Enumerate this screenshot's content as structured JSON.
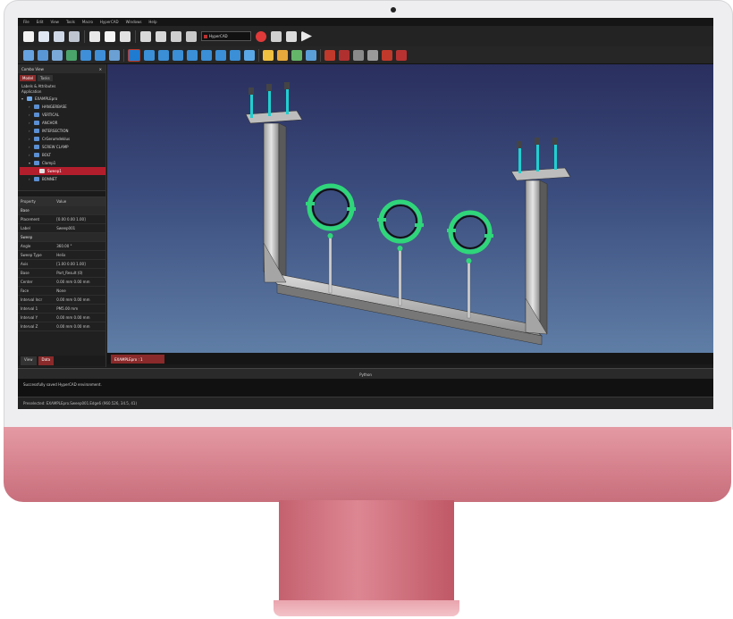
{
  "app": {
    "menu": [
      "File",
      "Edit",
      "View",
      "Tools",
      "Macro",
      "HyperCAD",
      "Windows",
      "Help"
    ],
    "workbench_combo": "HyperCAD"
  },
  "panel": {
    "title": "Combo View",
    "tabs": [
      "Model",
      "Tasks"
    ],
    "tree_header": "Labels & Attributes",
    "tree_root_label": "Application",
    "tree": [
      {
        "label": "EXAMPLEpro",
        "level": 0
      },
      {
        "label": "HANGERBASE",
        "level": 1
      },
      {
        "label": "VERTICAL",
        "level": 1
      },
      {
        "label": "ANCHOR",
        "level": 1
      },
      {
        "label": "INTERSECTION",
        "level": 1
      },
      {
        "label": "CrGerumdeklus",
        "level": 1
      },
      {
        "label": "SCREW CLAMP",
        "level": 1
      },
      {
        "label": "BOLT",
        "level": 1
      },
      {
        "label": "Clamp1",
        "level": 1
      },
      {
        "label": "Sweep1",
        "level": 2,
        "selected": true
      },
      {
        "label": "BONNET",
        "level": 1
      }
    ],
    "prop_headers": [
      "Property",
      "Value"
    ],
    "props": [
      {
        "group": true,
        "label": "Base"
      },
      {
        "label": "Placement",
        "value": "[0.00 0.00 1.00]"
      },
      {
        "label": "Label",
        "value": "Sweep001"
      },
      {
        "group": true,
        "label": "Sweep"
      },
      {
        "label": "Angle",
        "value": "360.00 °"
      },
      {
        "label": "Sweep Type",
        "value": "Helix"
      },
      {
        "label": "Axis",
        "value": "[1.00 0.00 1.00]"
      },
      {
        "label": "Base",
        "value": "Part_Result (0)"
      },
      {
        "label": "Center",
        "value": "0.00 mm 0.00 mm"
      },
      {
        "label": "Face",
        "value": "None"
      },
      {
        "label": "Interval Incr",
        "value": "0.00 mm 0.00 mm"
      },
      {
        "label": "Interval 1",
        "value": "PM5.00 mm"
      },
      {
        "label": "Interval Y",
        "value": "0.00 mm 0.00 mm"
      },
      {
        "label": "Interval Z",
        "value": "0.00 mm 0.00 mm"
      }
    ],
    "bottom_tabs": [
      "View",
      "Data"
    ]
  },
  "doc_tab": "EXAMPLEpro : 1",
  "python_console_label": "Python",
  "report_text": "Successfully saved HyperCAD environment.",
  "status_text": "Preselected: EXAMPLEpro.Sweep001.Edge6 (960.526, 34.5, 41)",
  "colors": {
    "viewport_top": "#2a2f5e",
    "viewport_bottom": "#5f7ea6",
    "selection": "#b31e2d",
    "clamp_green": "#2fd67a",
    "monitor_pink": "#d47f8b"
  }
}
